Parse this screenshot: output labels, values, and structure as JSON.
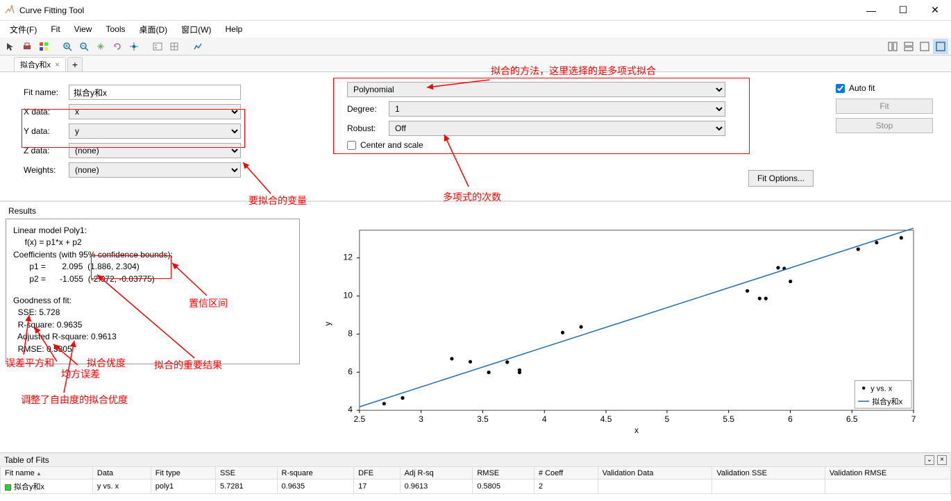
{
  "title": "Curve Fitting Tool",
  "menu": {
    "file": "文件(F)",
    "fit": "Fit",
    "view": "View",
    "tools": "Tools",
    "desktop": "桌面(D)",
    "window": "窗口(W)",
    "help": "Help"
  },
  "tab": {
    "name": "拟合y和x",
    "add": "+"
  },
  "left": {
    "fitname_label": "Fit name:",
    "fitname": "拟合y和x",
    "xdata_label": "X data:",
    "xdata": "x",
    "ydata_label": "Y data:",
    "ydata": "y",
    "zdata_label": "Z data:",
    "zdata": "(none)",
    "weights_label": "Weights:",
    "weights": "(none)"
  },
  "mid": {
    "type": "Polynomial",
    "degree_label": "Degree:",
    "degree": "1",
    "robust_label": "Robust:",
    "robust": "Off",
    "center_label": "Center and scale",
    "fitopt": "Fit Options..."
  },
  "right": {
    "autofit": "Auto fit",
    "fit": "Fit",
    "stop": "Stop"
  },
  "annots": {
    "a1": "拟合的方法，这里选择的是多项式拟合",
    "a2": "要拟合的变量",
    "a3": "多项式的次数",
    "a4": "置信区间",
    "a5": "误差平方和",
    "a6": "均方误差",
    "a7": "拟合优度",
    "a8": "拟合的重要结果",
    "a9": "调整了自由度的拟合优度"
  },
  "results": {
    "title": "Results",
    "l1": "Linear model Poly1:",
    "l2": "     f(x) = p1*x + p2",
    "l3": "Coefficients (with 95% confidence bounds):",
    "l4": "       p1 =       2.095  (1.886, 2.304)",
    "l5": "       p2 =      -1.055  (-2.072, -0.03775)",
    "l6": "Goodness of fit:",
    "l7": "  SSE: 5.728",
    "l8": "  R-square: 0.9635",
    "l9": "  Adjusted R-square: 0.9613",
    "l10": "  RMSE: 0.5805"
  },
  "table": {
    "bar": "Table of Fits",
    "headers": [
      "Fit name",
      "Data",
      "Fit type",
      "SSE",
      "R-square",
      "DFE",
      "Adj R-sq",
      "RMSE",
      "# Coeff",
      "Validation Data",
      "Validation SSE",
      "Validation RMSE"
    ],
    "row": {
      "name": "拟合y和x",
      "data": "y vs. x",
      "type": "poly1",
      "sse": "5.7281",
      "rsq": "0.9635",
      "dfe": "17",
      "adj": "0.9613",
      "rmse": "0.5805",
      "coeff": "2",
      "vd": "",
      "vsse": "",
      "vrmse": ""
    }
  },
  "chart_data": {
    "type": "scatter+line",
    "xlabel": "x",
    "ylabel": "y",
    "xlim": [
      2.5,
      7
    ],
    "ylim": [
      4,
      13.5
    ],
    "xticks": [
      2.5,
      3,
      3.5,
      4,
      4.5,
      5,
      5.5,
      6,
      6.5,
      7
    ],
    "yticks": [
      4,
      6,
      8,
      10,
      12
    ],
    "legend": {
      "scatter": "y vs. x",
      "line": "拟合y和x"
    },
    "line_p1": 2.095,
    "line_p2": -1.055,
    "points": [
      [
        2.7,
        4.35
      ],
      [
        2.85,
        4.65
      ],
      [
        3.25,
        6.72
      ],
      [
        3.4,
        6.56
      ],
      [
        3.55,
        6.0
      ],
      [
        3.7,
        6.54
      ],
      [
        3.8,
        6.0
      ],
      [
        3.8,
        6.12
      ],
      [
        4.15,
        8.1
      ],
      [
        4.3,
        8.4
      ],
      [
        5.65,
        10.3
      ],
      [
        5.75,
        9.9
      ],
      [
        5.8,
        9.9
      ],
      [
        5.9,
        11.52
      ],
      [
        5.95,
        11.48
      ],
      [
        6.0,
        10.8
      ],
      [
        6.55,
        12.5
      ],
      [
        6.7,
        12.85
      ],
      [
        6.9,
        13.1
      ]
    ]
  }
}
